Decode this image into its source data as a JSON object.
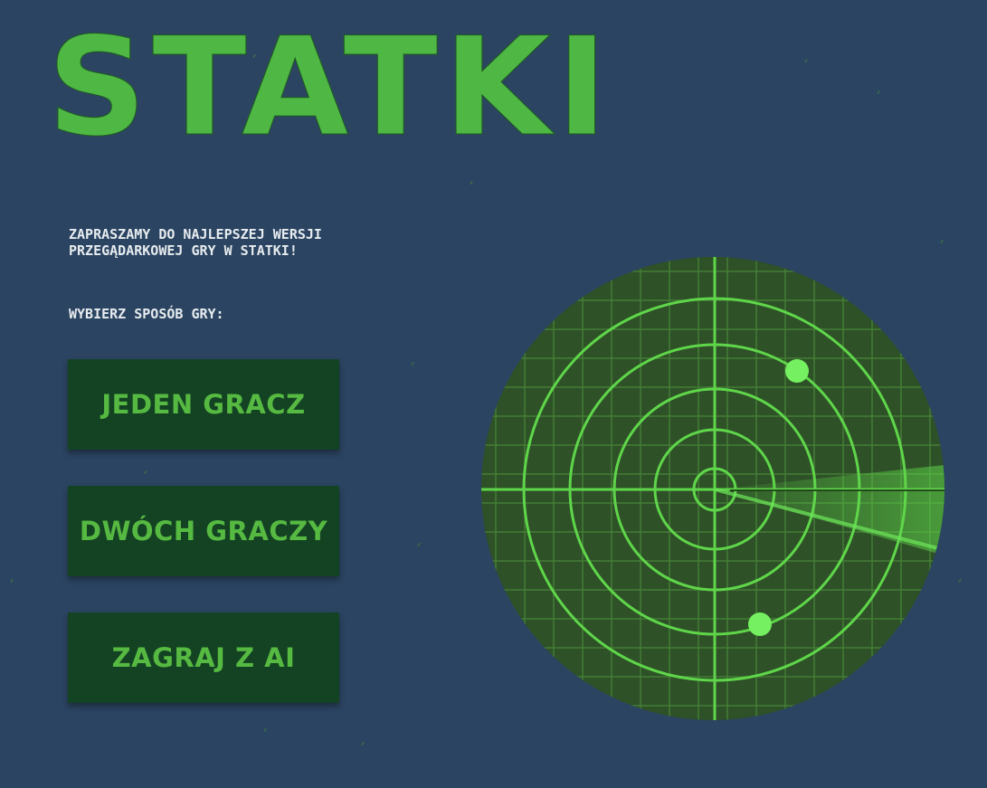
{
  "title": "STATKI",
  "intro": "ZAPRASZAMY DO NAJLEPSZEJ WERSJI PRZEGĄDARKOWEJ GRY W STATKI!",
  "choose_label": "WYBIERZ SPOSÓB GRY:",
  "menu": {
    "single_player": "JEDEN GRACZ",
    "two_players": "DWÓCH GRACZY",
    "vs_ai": "ZAGRAJ Z AI"
  },
  "colors": {
    "background": "#2b4461",
    "title_green": "#4fb845",
    "button_bg": "#134323",
    "button_text": "#56b941",
    "radar_bg": "#2e5127",
    "radar_line": "#5fd64a",
    "blip": "#74f060"
  },
  "icons": {
    "radar": "radar-icon"
  }
}
